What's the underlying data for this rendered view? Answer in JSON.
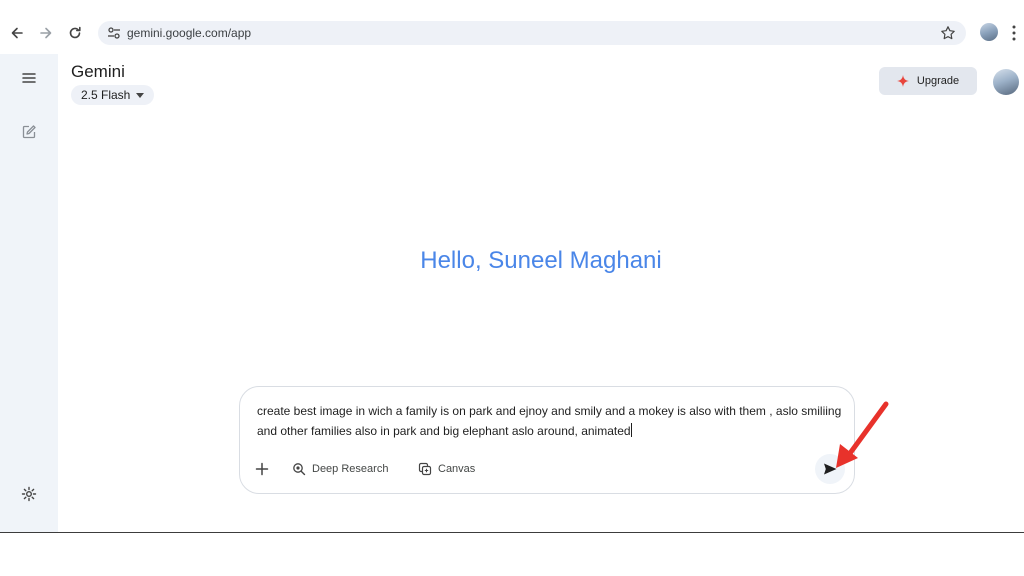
{
  "browser": {
    "url": "gemini.google.com/app",
    "icons": [
      "back-icon",
      "forward-icon",
      "reload-icon",
      "site-settings-icon",
      "star-icon",
      "profile-avatar",
      "kebab-menu-icon"
    ]
  },
  "rail": {
    "icons": [
      "hamburger-menu-icon",
      "new-chat-icon",
      "settings-gear-icon"
    ]
  },
  "header": {
    "app_title": "Gemini",
    "model": "2.5 Flash",
    "upgrade_label": "Upgrade"
  },
  "greeting": "Hello, Suneel Maghani",
  "composer": {
    "prompt_text": "create best image in wich a family is on park and ejnoy and smily and a mokey is also with them , aslo smiliing and other families also in park and big elephant aslo around, animated",
    "tools": {
      "deep_research": "Deep Research",
      "canvas": "Canvas"
    }
  },
  "colors": {
    "greeting": "#4a86e8",
    "upgrade_spark": "#e8453c",
    "annotation_arrow": "#e8322b",
    "rail_bg": "#f0f4f9"
  }
}
